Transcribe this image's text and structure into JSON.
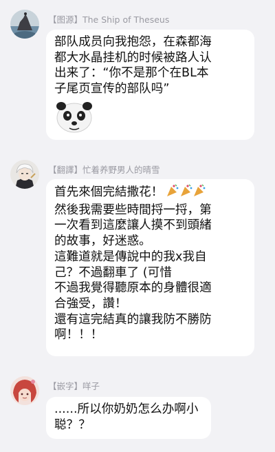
{
  "messages": [
    {
      "sender": "【图源】The Ship of Theseus",
      "lines": [
        "部队成员向我抱怨，在森都海",
        "都大水晶挂机的时候被路人认",
        "出来了：“你不是那个在BL本",
        "子尾页宣传的部队吗”"
      ],
      "sticker": "panda-sticker",
      "avatar": "ship-rock-avatar"
    },
    {
      "sender": "【翻譯】忙着养野男人的晴雪",
      "lines": [
        "首先來個完結撒花！",
        "然後我需要些時間捋一捋，第",
        "一次看到這麼讓人摸不到頭緒",
        "的故事，好迷惑。",
        "這難道就是傳說中的我x我自",
        "己？不過翻車了 (可惜",
        "不過我覺得聽原本的身體很適",
        "合強受，讚！",
        "還有這完結真的讓我防不勝防",
        "啊！！！"
      ],
      "emoji": "party-popper-icon",
      "avatar": "white-hair-avatar"
    },
    {
      "sender": "【嵌字】咩子",
      "lines": [
        "......所以你奶奶怎么办啊小",
        "聪？？"
      ],
      "avatar": "red-hair-avatar"
    }
  ]
}
